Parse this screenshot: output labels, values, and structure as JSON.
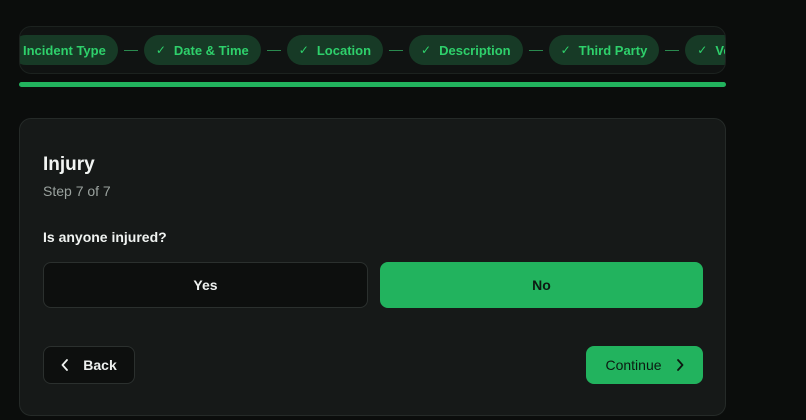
{
  "stepper": {
    "steps": [
      {
        "label": "Incident Type",
        "completed": false
      },
      {
        "label": "Date & Time",
        "completed": true
      },
      {
        "label": "Location",
        "completed": true
      },
      {
        "label": "Description",
        "completed": true
      },
      {
        "label": "Third Party",
        "completed": true
      },
      {
        "label": "Vehicle",
        "completed": true
      }
    ],
    "check_icon": "✓",
    "progress": 1.0
  },
  "card": {
    "title": "Injury",
    "subtitle": "Step 7 of 7",
    "question": "Is anyone injured?",
    "options": {
      "yes": "Yes",
      "no": "No",
      "selected": "No"
    }
  },
  "actions": {
    "back_label": "Back",
    "continue_label": "Continue",
    "back_icon": "chevron-left-icon",
    "continue_icon": "chevron-right-icon"
  },
  "colors": {
    "accent": "#22b35e",
    "background": "#0b0d0c",
    "card": "#161918",
    "chip_bg": "#173a26",
    "chip_text": "#2ed06b"
  }
}
